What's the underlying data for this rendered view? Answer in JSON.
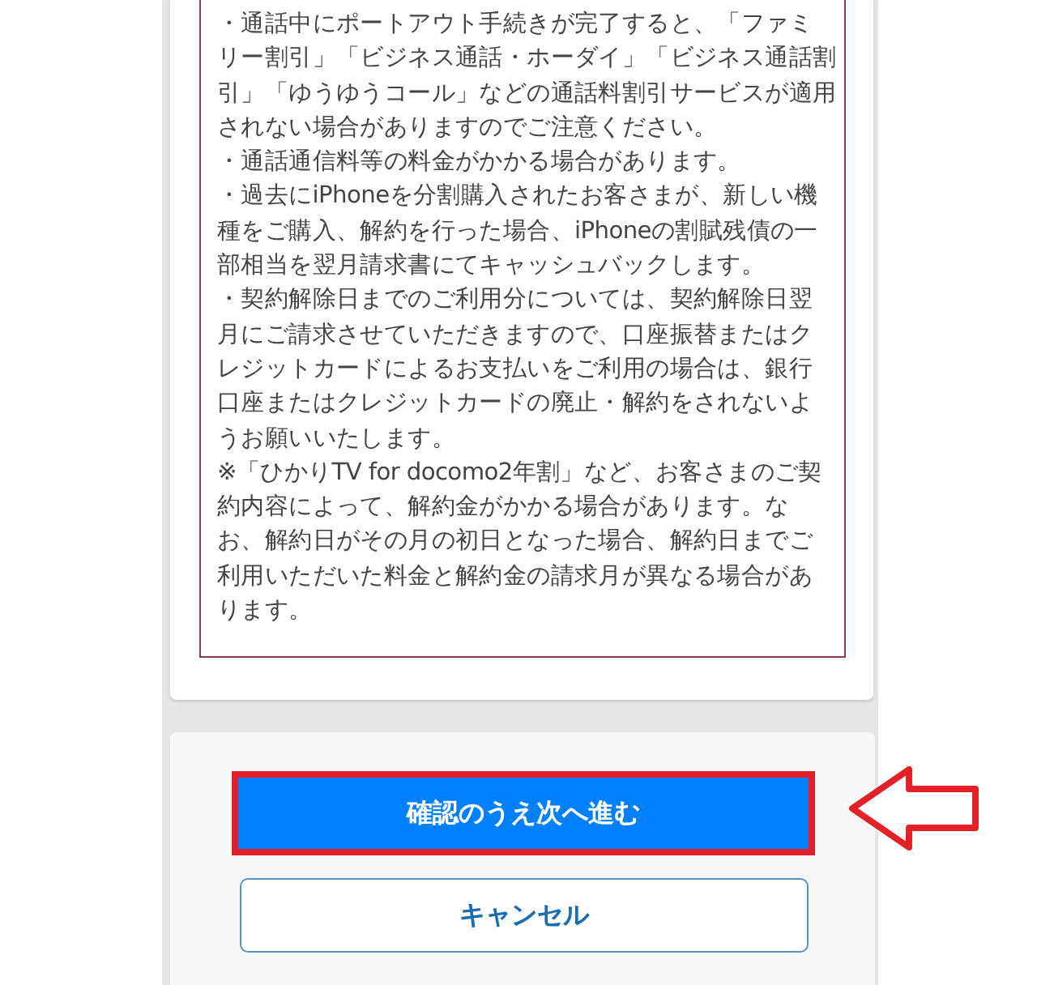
{
  "notice": {
    "paragraphs": [
      [
        "・通話中にポートアウト手続きが完了すると、「ファミ",
        "リー割引」「ビジネス通話・ホーダイ」「ビジネス通話割",
        "引」「ゆうゆうコール」などの通話料割引サービスが適用",
        "されない場合がありますのでご注意ください。"
      ],
      [
        "・通話通信料等の料金がかかる場合があります。"
      ],
      [
        "・過去にiPhoneを分割購入されたお客さまが、新しい機",
        "種をご購入、解約を行った場合、iPhoneの割賦残債の一",
        "部相当を翌月請求書にてキャッシュバックします。"
      ],
      [
        "・契約解除日までのご利用分については、契約解除日翌",
        "月にご請求させていただきますので、口座振替またはク",
        "レジットカードによるお支払いをご利用の場合は、銀行",
        "口座またはクレジットカードの廃止・解約をされないよ",
        "うお願いいたします。"
      ],
      [
        "※「ひかりTV for docomo2年割」など、お客さまのご契",
        "約内容によって、解約金がかかる場合があります。な",
        "お、解約日がその月の初日となった場合、解約日までご",
        "利用いただいた料金と解約金の請求月が異なる場合があ",
        "ります。"
      ]
    ]
  },
  "buttons": [
    {
      "kind": "primary",
      "label": "確認のうえ次へ進む",
      "highlighted": true
    },
    {
      "kind": "secondary",
      "label": "キャンセル",
      "highlighted": false
    }
  ]
}
